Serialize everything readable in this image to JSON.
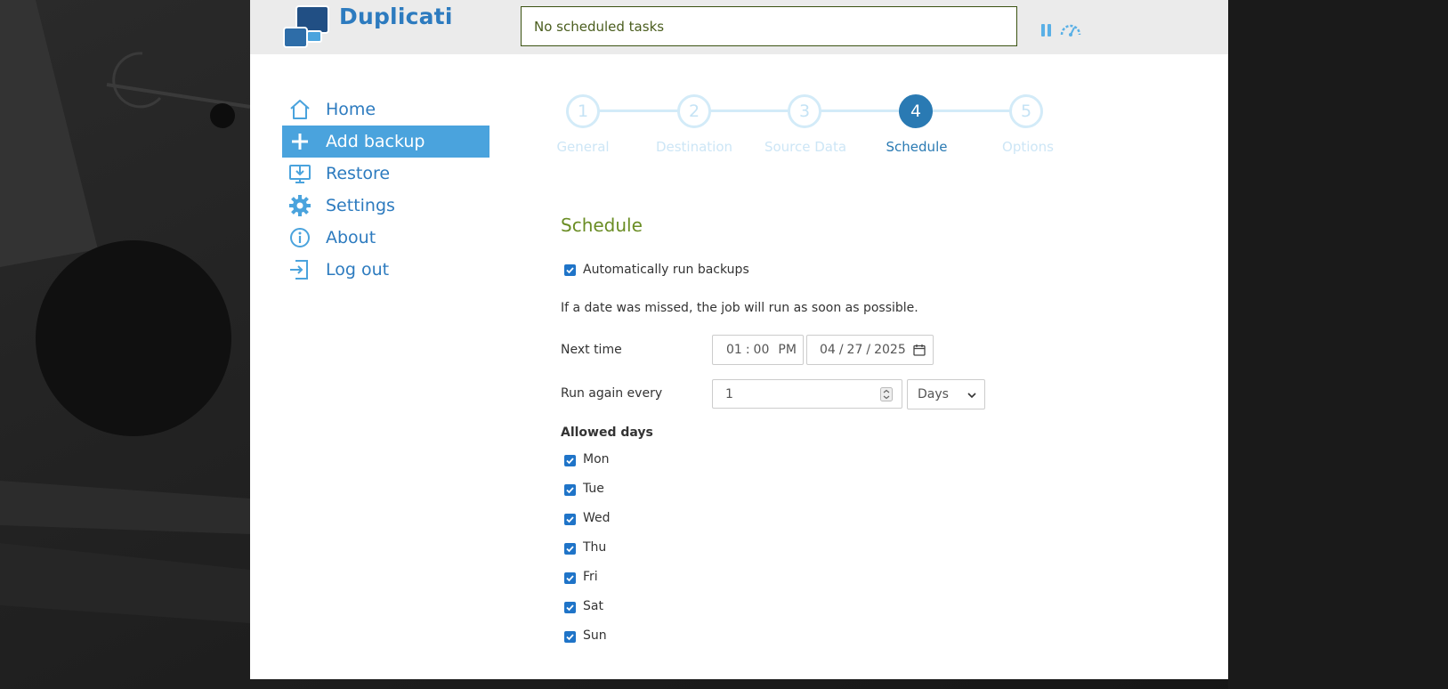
{
  "app": {
    "name": "Duplicati"
  },
  "status": {
    "text": "No scheduled tasks"
  },
  "nav": {
    "items": [
      {
        "label": "Home",
        "icon": "home-icon"
      },
      {
        "label": "Add backup",
        "icon": "plus-icon",
        "active": true
      },
      {
        "label": "Restore",
        "icon": "restore-icon"
      },
      {
        "label": "Settings",
        "icon": "gear-icon"
      },
      {
        "label": "About",
        "icon": "info-icon"
      },
      {
        "label": "Log out",
        "icon": "logout-icon"
      }
    ]
  },
  "wizard": {
    "current_step": 4,
    "steps": [
      {
        "number": "1",
        "label": "General"
      },
      {
        "number": "2",
        "label": "Destination"
      },
      {
        "number": "3",
        "label": "Source Data"
      },
      {
        "number": "4",
        "label": "Schedule"
      },
      {
        "number": "5",
        "label": "Options"
      }
    ]
  },
  "schedule": {
    "title": "Schedule",
    "auto_run_label": "Automatically run backups",
    "auto_run_checked": true,
    "missed_note": "If a date was missed, the job will run as soon as possible.",
    "next_time_label": "Next time",
    "time": {
      "hour": "01",
      "minute": "00",
      "ampm": "PM"
    },
    "date": {
      "month": "04",
      "day": "27",
      "year": "2025"
    },
    "run_again_label": "Run again every",
    "interval_value": "1",
    "interval_unit": "Days",
    "allowed_days_title": "Allowed days",
    "days": [
      {
        "label": "Mon",
        "checked": true
      },
      {
        "label": "Tue",
        "checked": true
      },
      {
        "label": "Wed",
        "checked": true
      },
      {
        "label": "Thu",
        "checked": true
      },
      {
        "label": "Fri",
        "checked": true
      },
      {
        "label": "Sat",
        "checked": true
      },
      {
        "label": "Sun",
        "checked": true
      }
    ]
  },
  "colors": {
    "brand": "#2d7bbf",
    "nav_active_bg": "#4aa3dd",
    "step_active": "#2a7ab3",
    "section_title": "#6a8d24",
    "checkbox": "#1f74c8"
  }
}
